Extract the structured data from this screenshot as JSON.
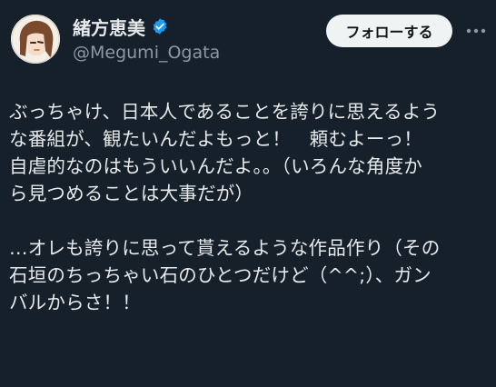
{
  "author": {
    "display_name": "緒方恵美",
    "handle": "@Megumi_Ogata",
    "verified": true
  },
  "actions": {
    "follow_label": "フォローする",
    "more_icon": "more-horizontal-icon"
  },
  "tweet": {
    "paragraph_1": [
      "ぶっちゃけ、日本人であることを誇りに思えるよう",
      "な番組が、観たいんだよもっと！　頼むよーっ！",
      "自虐的なのはもういいんだよ。。（いろんな角度か",
      "ら見つめることは大事だが）"
    ],
    "paragraph_2": [
      "…オレも誇りに思って貰えるような作品作り（その",
      "石垣のちっちゃい石のひとつだけど（^^;）、ガン",
      "バルからさ！！"
    ]
  },
  "colors": {
    "background": "#15202b",
    "text": "#e7e9ea",
    "secondary_text": "#8b98a5",
    "verified_blue": "#1d9bf0",
    "follow_button_bg": "#eff3f4"
  }
}
